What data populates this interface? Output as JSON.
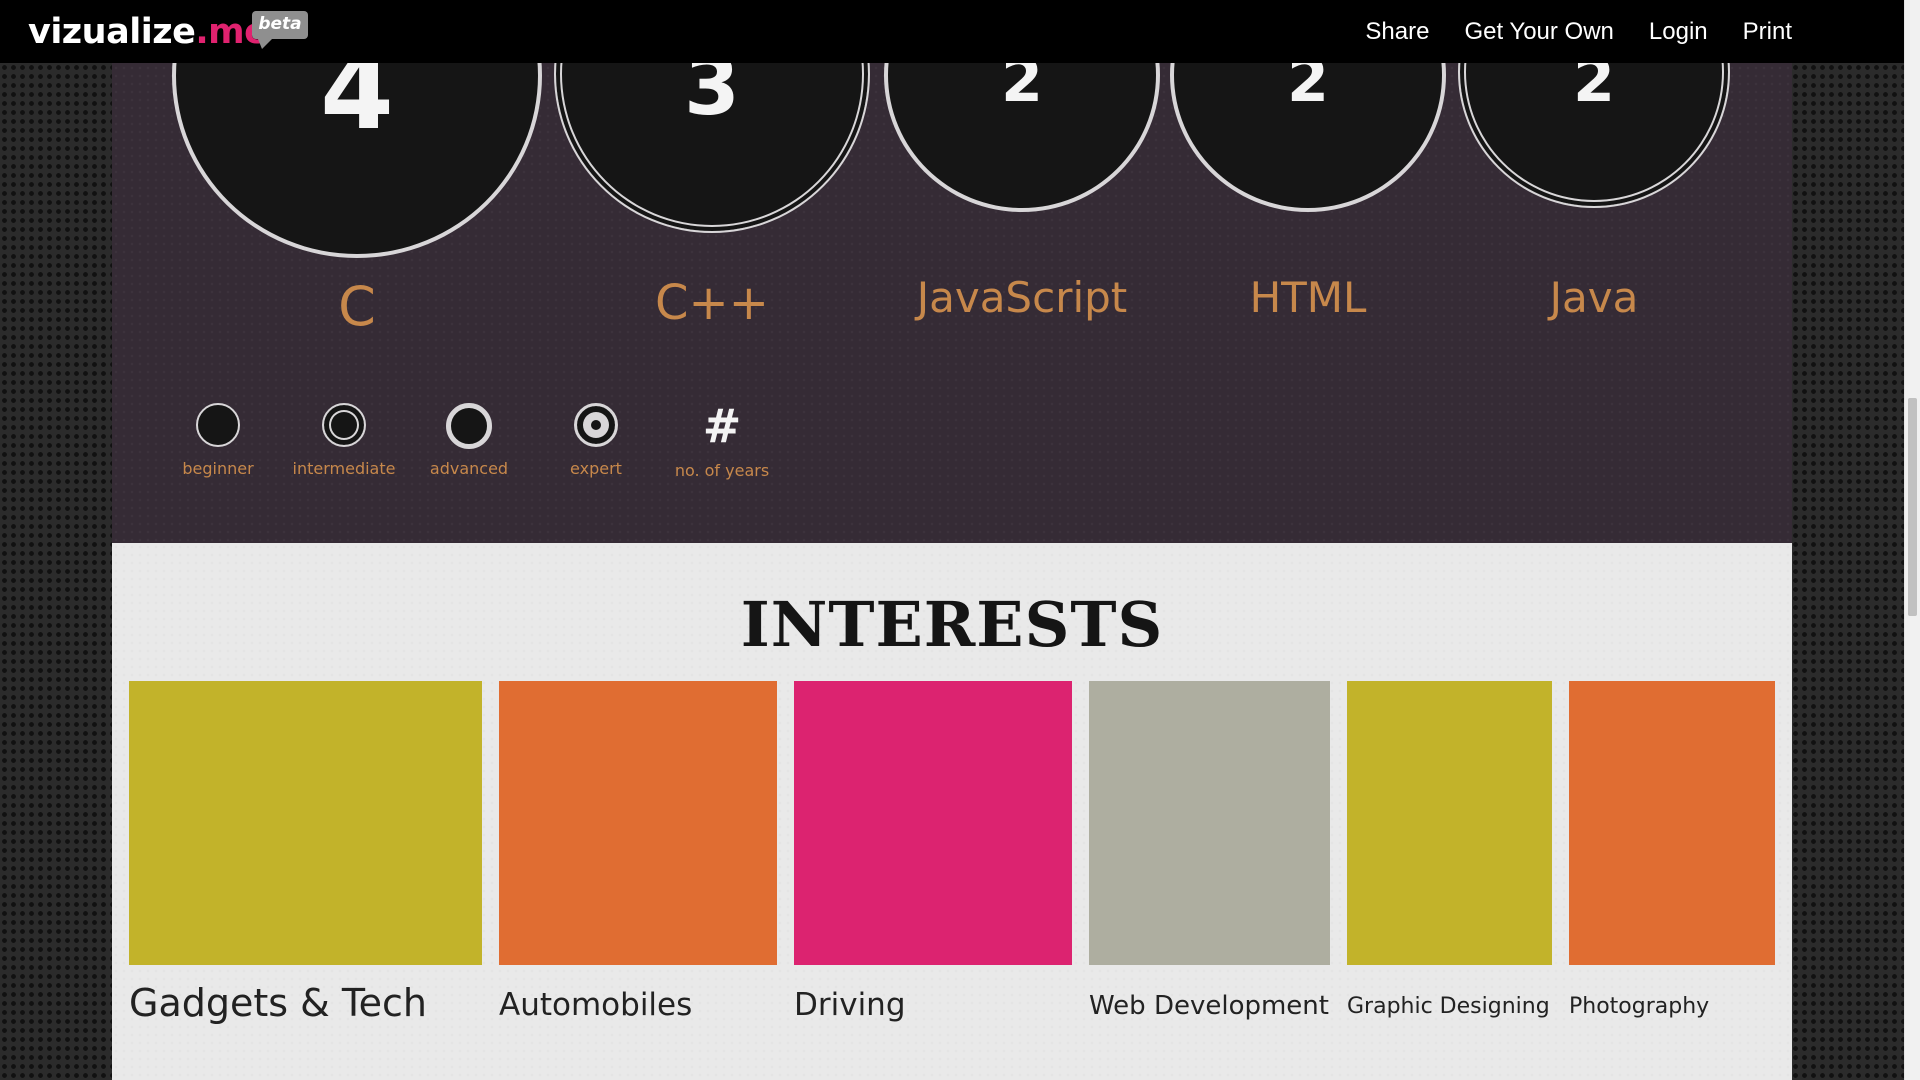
{
  "navbar": {
    "logo_text": "vizualize",
    "logo_tld": ".me",
    "beta_badge": "beta",
    "links": [
      "Share",
      "Get Your Own",
      "Login",
      "Print"
    ]
  },
  "skills": [
    {
      "name": "C",
      "years": "4",
      "level": "expert"
    },
    {
      "name": "C++",
      "years": "3",
      "level": "intermediate"
    },
    {
      "name": "JavaScript",
      "years": "2",
      "level": "expert"
    },
    {
      "name": "HTML",
      "years": "2",
      "level": "expert"
    },
    {
      "name": "Java",
      "years": "2",
      "level": "intermediate"
    }
  ],
  "legend": [
    {
      "label": "beginner",
      "symbol": "filled-circle-icon"
    },
    {
      "label": "intermediate",
      "symbol": "double-ring-icon"
    },
    {
      "label": "advanced",
      "symbol": "thick-ring-icon"
    },
    {
      "label": "expert",
      "symbol": "target-ring-icon"
    },
    {
      "label": "no. of years",
      "symbol": "#"
    }
  ],
  "interests": {
    "title": "INTERESTS",
    "items": [
      {
        "label": "Gadgets & Tech",
        "color": "#c2b32a"
      },
      {
        "label": "Automobiles",
        "color": "#e06d32"
      },
      {
        "label": "Driving",
        "color": "#dc2370"
      },
      {
        "label": "Web Development",
        "color": "#aeaea0"
      },
      {
        "label": "Graphic Designing",
        "color": "#c2b32a"
      },
      {
        "label": "Photography",
        "color": "#e06d32"
      }
    ]
  },
  "colors": {
    "skills_bg": "#352b35",
    "skill_name": "#c7884b",
    "interests_bg": "#e9e9e9",
    "brand_pink": "#e0226f"
  }
}
